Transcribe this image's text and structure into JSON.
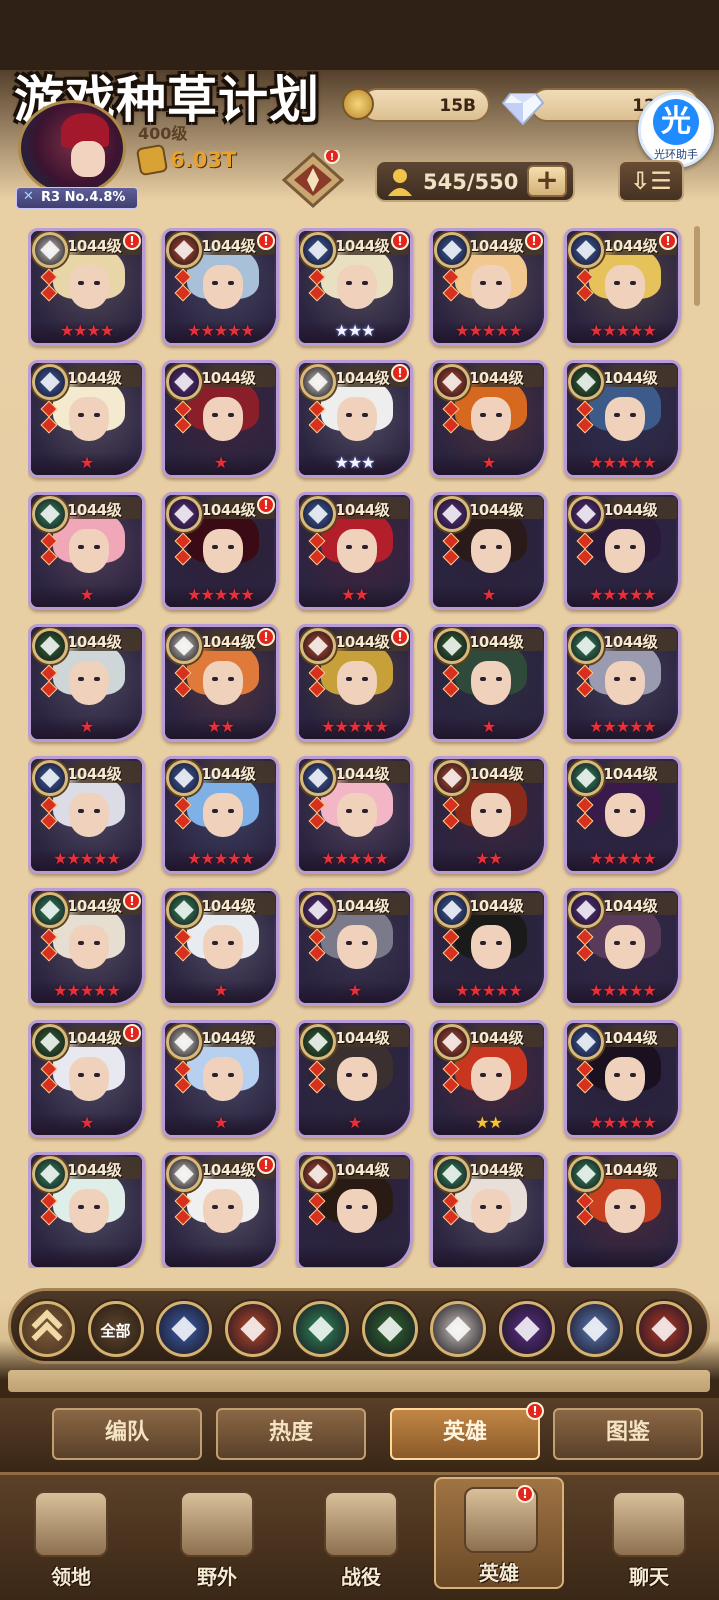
{
  "watermark": "游戏种草计划",
  "resources": {
    "gold": "15B",
    "diamonds": "12,12"
  },
  "helper_badge": {
    "glyph": "光",
    "label": "光环助手"
  },
  "player": {
    "level": "400级",
    "power": "6.03T",
    "rank": "R3 No.4.8%"
  },
  "hero_count": "545/550",
  "hero_list": [
    {
      "level": "1044级",
      "faction": "celestial",
      "stars": 4,
      "star_color": "red",
      "notif": true
    },
    {
      "level": "1044级",
      "faction": "mauler",
      "stars": 5,
      "star_color": "red",
      "notif": true
    },
    {
      "level": "1044级",
      "faction": "lightbearer",
      "stars": 3,
      "star_color": "white",
      "notif": true
    },
    {
      "level": "1044级",
      "faction": "lightbearer",
      "stars": 5,
      "star_color": "red",
      "notif": true
    },
    {
      "level": "1044级",
      "faction": "lightbearer",
      "stars": 5,
      "star_color": "red",
      "notif": true
    },
    {
      "level": "1044级",
      "faction": "lightbearer",
      "stars": 1,
      "star_color": "red",
      "notif": false
    },
    {
      "level": "1044级",
      "faction": "graveborn",
      "stars": 1,
      "star_color": "red",
      "notif": false
    },
    {
      "level": "1044级",
      "faction": "celestial",
      "stars": 3,
      "star_color": "white",
      "notif": true
    },
    {
      "level": "1044级",
      "faction": "mauler",
      "stars": 1,
      "star_color": "red",
      "notif": false
    },
    {
      "level": "1044级",
      "faction": "wilder-eye",
      "stars": 5,
      "star_color": "red",
      "notif": false
    },
    {
      "level": "1044级",
      "faction": "wilder",
      "stars": 1,
      "star_color": "red",
      "notif": false
    },
    {
      "level": "1044级",
      "faction": "graveborn",
      "stars": 5,
      "star_color": "red",
      "notif": true
    },
    {
      "level": "1044级",
      "faction": "lightbearer",
      "stars": 2,
      "star_color": "red",
      "notif": false
    },
    {
      "level": "1044级",
      "faction": "graveborn",
      "stars": 1,
      "star_color": "red",
      "notif": false
    },
    {
      "level": "1044级",
      "faction": "graveborn",
      "stars": 5,
      "star_color": "red",
      "notif": false
    },
    {
      "level": "1044级",
      "faction": "wilder-eye",
      "stars": 1,
      "star_color": "red",
      "notif": false
    },
    {
      "level": "1044级",
      "faction": "celestial",
      "stars": 2,
      "star_color": "red",
      "notif": true
    },
    {
      "level": "1044级",
      "faction": "mauler",
      "stars": 5,
      "star_color": "red",
      "notif": true
    },
    {
      "level": "1044级",
      "faction": "wilder-eye",
      "stars": 1,
      "star_color": "red",
      "notif": false
    },
    {
      "level": "1044级",
      "faction": "wilder",
      "stars": 5,
      "star_color": "red",
      "notif": false
    },
    {
      "level": "1044级",
      "faction": "lightbearer",
      "stars": 5,
      "star_color": "red",
      "notif": false
    },
    {
      "level": "1044级",
      "faction": "lightbearer",
      "stars": 5,
      "star_color": "red",
      "notif": false
    },
    {
      "level": "1044级",
      "faction": "lightbearer",
      "stars": 5,
      "star_color": "red",
      "notif": false
    },
    {
      "level": "1044级",
      "faction": "mauler",
      "stars": 2,
      "star_color": "red",
      "notif": false
    },
    {
      "level": "1044级",
      "faction": "wilder",
      "stars": 5,
      "star_color": "red",
      "notif": false
    },
    {
      "level": "1044级",
      "faction": "wilder",
      "stars": 5,
      "star_color": "red",
      "notif": true
    },
    {
      "level": "1044级",
      "faction": "wilder",
      "stars": 1,
      "star_color": "red",
      "notif": false
    },
    {
      "level": "1044级",
      "faction": "graveborn",
      "stars": 1,
      "star_color": "red",
      "notif": false
    },
    {
      "level": "1044级",
      "faction": "lightbearer",
      "stars": 5,
      "star_color": "red",
      "notif": false
    },
    {
      "level": "1044级",
      "faction": "graveborn",
      "stars": 5,
      "star_color": "red",
      "notif": false
    },
    {
      "level": "1044级",
      "faction": "wilder-eye",
      "stars": 1,
      "star_color": "red",
      "notif": true
    },
    {
      "level": "1044级",
      "faction": "celestial",
      "stars": 1,
      "star_color": "red",
      "notif": false
    },
    {
      "level": "1044级",
      "faction": "wilder-eye",
      "stars": 1,
      "star_color": "red",
      "notif": false
    },
    {
      "level": "1044级",
      "faction": "mauler",
      "stars": 2,
      "star_color": "gold",
      "notif": false
    },
    {
      "level": "1044级",
      "faction": "lightbearer",
      "stars": 5,
      "star_color": "red",
      "notif": false
    },
    {
      "level": "1044级",
      "faction": "wilder",
      "stars": 0,
      "star_color": "red",
      "notif": false
    },
    {
      "level": "1044级",
      "faction": "celestial",
      "stars": 0,
      "star_color": "red",
      "notif": true
    },
    {
      "level": "1044级",
      "faction": "mauler",
      "stars": 0,
      "star_color": "red",
      "notif": false
    },
    {
      "level": "1044级",
      "faction": "wilder",
      "stars": 0,
      "star_color": "red",
      "notif": false
    },
    {
      "level": "1044级",
      "faction": "wilder",
      "stars": 0,
      "star_color": "red",
      "notif": false
    }
  ],
  "faction_filters": [
    {
      "id": "collapse",
      "icon": "chevron-up-icon"
    },
    {
      "id": "all",
      "label": "全部"
    },
    {
      "id": "lightbearer",
      "icon": "lightbearer-icon"
    },
    {
      "id": "mauler",
      "icon": "mauler-icon"
    },
    {
      "id": "wilder",
      "icon": "wilder-icon"
    },
    {
      "id": "wilder-eye",
      "icon": "wilder-eye-icon"
    },
    {
      "id": "celestial",
      "icon": "celestial-icon"
    },
    {
      "id": "graveborn",
      "icon": "graveborn-icon"
    },
    {
      "id": "dimensional",
      "icon": "dimensional-icon"
    },
    {
      "id": "hypogean",
      "icon": "hypogean-icon"
    }
  ],
  "colors": {
    "lightbearer": "#3b5ea8",
    "mauler": "#b8492a",
    "wilder": "#2f8a5a",
    "wilder-eye": "#2d6a2f",
    "celestial": "#c8c4b8",
    "graveborn": "#5b2f86",
    "dimensional": "#5b79b5",
    "hypogean": "#b23a2a",
    "star_red": "#e7303a",
    "star_white": "#f4f4ff",
    "star_gold": "#f3c33a",
    "notif": "#e3261d"
  },
  "sub_tabs": [
    {
      "label": "编队",
      "active": false,
      "notif": false
    },
    {
      "label": "热度",
      "active": false,
      "notif": false
    },
    {
      "label": "英雄",
      "active": true,
      "notif": true
    },
    {
      "label": "图鉴",
      "active": false,
      "notif": false
    }
  ],
  "nav": [
    {
      "label": "领地",
      "icon": "castle-icon",
      "active": false,
      "notif": false
    },
    {
      "label": "野外",
      "icon": "map-scroll-icon",
      "active": false,
      "notif": false
    },
    {
      "label": "战役",
      "icon": "swords-shield-icon",
      "active": false,
      "notif": false
    },
    {
      "label": "英雄",
      "icon": "helmet-icon",
      "active": true,
      "notif": true
    },
    {
      "label": "聊天",
      "icon": "chat-bubble-icon",
      "active": false,
      "notif": false
    }
  ]
}
